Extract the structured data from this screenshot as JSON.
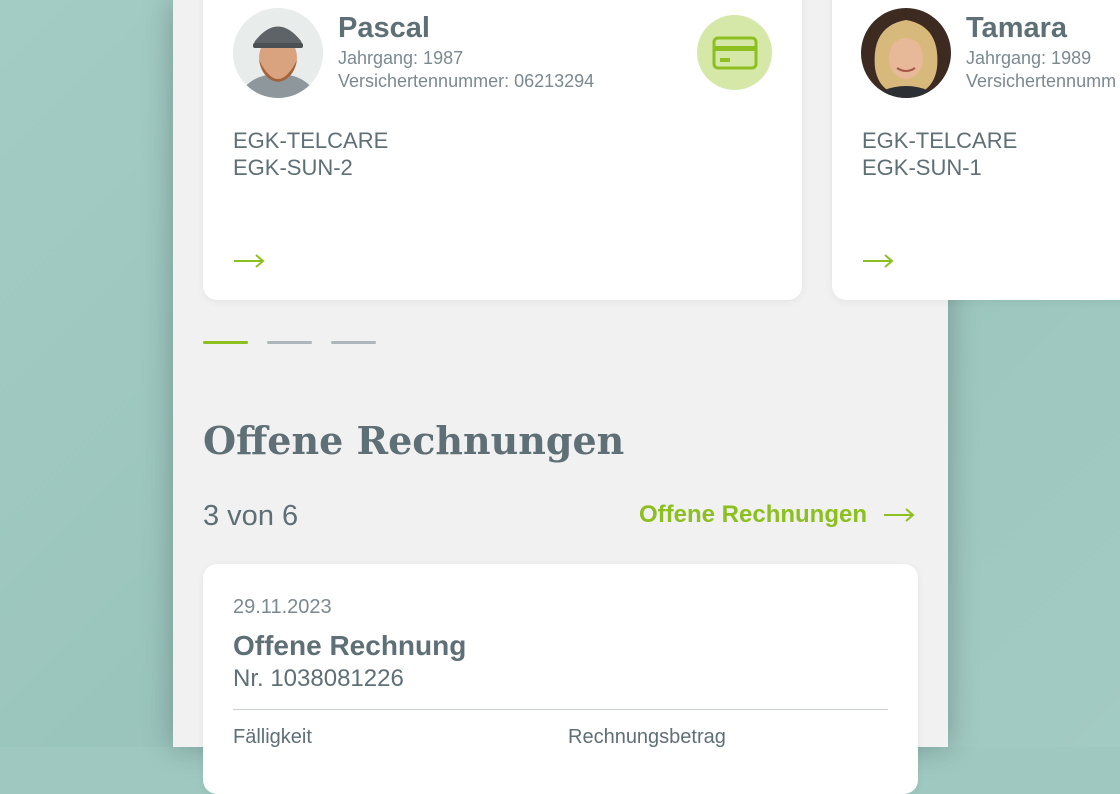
{
  "people": [
    {
      "name": "Pascal",
      "jahrgang": "Jahrgang: 1987",
      "versichertennummer": "Versichertennummer: 06213294",
      "products": [
        "EGK-TELCARE",
        "EGK-SUN-2"
      ],
      "has_card_badge": true
    },
    {
      "name": "Tamara",
      "jahrgang": "Jahrgang: 1989",
      "versichertennummer": "Versichertennumm",
      "products": [
        "EGK-TELCARE",
        "EGK-SUN-1"
      ],
      "has_card_badge": false
    }
  ],
  "carousel": {
    "pages": 3,
    "active_index": 0
  },
  "open_invoices": {
    "title": "Offene Rechnungen",
    "count_text": "3 von 6",
    "link_label": "Offene Rechnungen",
    "items": [
      {
        "date": "29.11.2023",
        "title": "Offene Rechnung",
        "number": "Nr. 1038081226",
        "col_due_label": "Fälligkeit",
        "col_amount_label": "Rechnungsbetrag"
      }
    ]
  },
  "colors": {
    "accent": "#8cbf1f",
    "badge_bg": "#d6e8a8",
    "text": "#5f6f76",
    "muted": "#7b8990",
    "indicator_inactive": "#aeb6ba"
  },
  "icons": {
    "card": "credit-card-icon",
    "arrow": "arrow-right-icon"
  }
}
